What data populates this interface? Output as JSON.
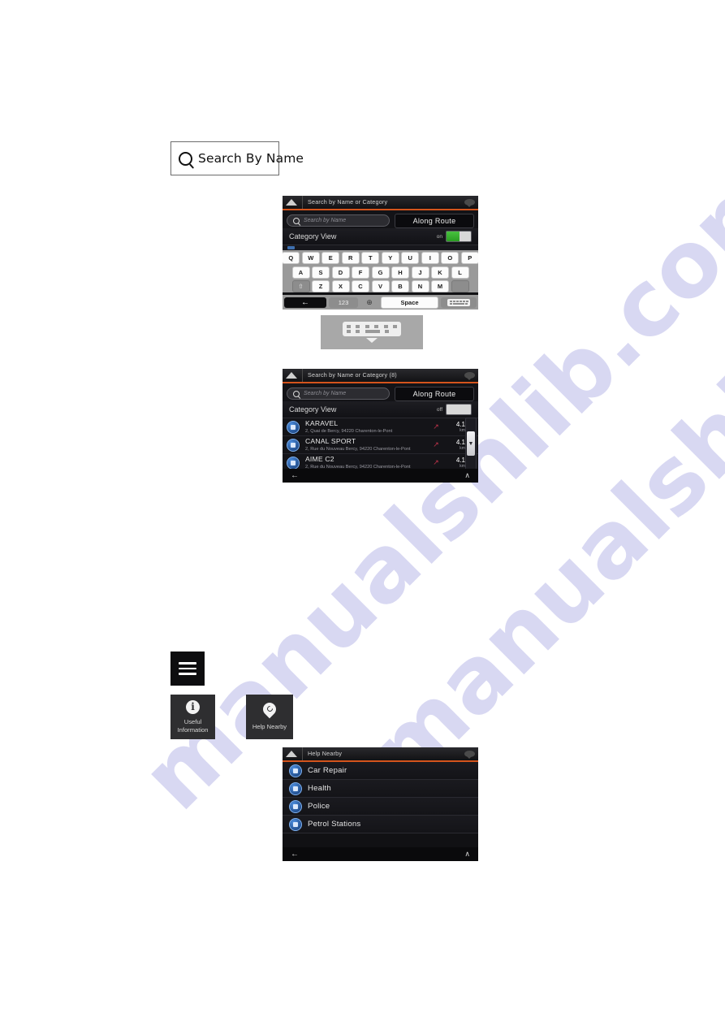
{
  "watermark": {
    "text": "manualshlib.com"
  },
  "search_by_name_button": {
    "label": "Search By Name",
    "icon": "search-icon"
  },
  "screen_keyboard": {
    "title": "Search by Name or Category",
    "search_placeholder": "Search by Name",
    "along_route_label": "Along Route",
    "category_view_label": "Category View",
    "category_view_state": "on",
    "keyboard": {
      "row1": [
        "Q",
        "W",
        "E",
        "R",
        "T",
        "Y",
        "U",
        "I",
        "O",
        "P"
      ],
      "row2": [
        "A",
        "S",
        "D",
        "F",
        "G",
        "H",
        "J",
        "K",
        "L"
      ],
      "row3": [
        "⇧",
        "Z",
        "X",
        "C",
        "V",
        "B",
        "N",
        "M",
        ""
      ],
      "back_label": "←",
      "numbers_label": "123",
      "language_label": "⊕",
      "space_label": "Space",
      "hide_keyboard_label": "keyboard-icon"
    }
  },
  "keyboard_hide_button": {
    "icon": "hide-keyboard-icon"
  },
  "screen_results": {
    "title": "Search by Name or Category (8)",
    "search_placeholder": "Search by Name",
    "along_route_label": "Along Route",
    "category_view_label": "Category View",
    "category_view_state": "off",
    "results": [
      {
        "name": "KARAVEL",
        "address": "2, Quai de Bercy, 94220 Charenton-le-Pont",
        "distance": "4.1",
        "unit": "km"
      },
      {
        "name": "CANAL SPORT",
        "address": "2, Rue du Nouveau Bercy, 94220 Charenton-le-Pont",
        "distance": "4.1",
        "unit": "km"
      },
      {
        "name": "AIME C2",
        "address": "2, Rue du Nouveau Bercy, 94220 Charenton-le-Pont",
        "distance": "4.1",
        "unit": "km"
      }
    ],
    "back_label": "←",
    "up_label": "∧",
    "scroll_thumb_label": "▼"
  },
  "menu_button": {
    "icon": "hamburger-menu-icon"
  },
  "tiles": [
    {
      "label": "Useful\nInformation",
      "label_line1": "Useful",
      "label_line2": "Information",
      "icon": "info-icon"
    },
    {
      "label": "Help Nearby",
      "icon": "help-pin-icon"
    }
  ],
  "screen_help_nearby": {
    "title": "Help Nearby",
    "items": [
      {
        "label": "Car Repair",
        "icon": "car-repair-icon"
      },
      {
        "label": "Health",
        "icon": "health-cross-icon"
      },
      {
        "label": "Police",
        "icon": "police-icon"
      },
      {
        "label": "Petrol Stations",
        "icon": "petrol-pump-icon"
      }
    ],
    "back_label": "←",
    "up_label": "∧"
  }
}
